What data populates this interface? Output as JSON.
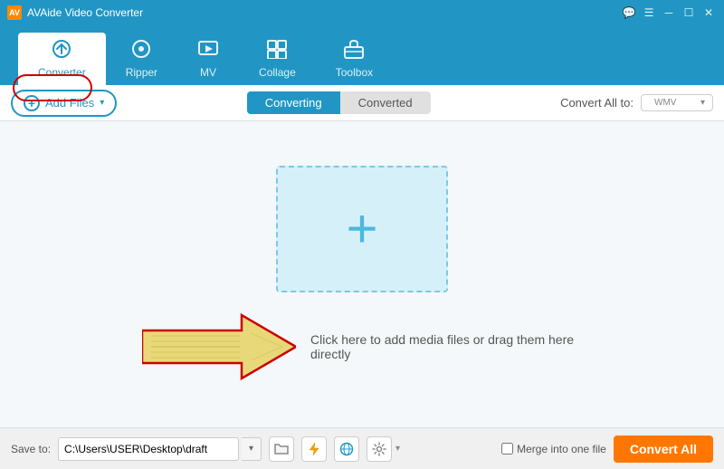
{
  "app": {
    "title": "AVAide Video Converter",
    "logo_text": "AV"
  },
  "titlebar": {
    "controls": [
      "⊟",
      "☐",
      "✕"
    ],
    "extra_icon": "⊞"
  },
  "nav": {
    "items": [
      {
        "label": "Converter",
        "icon": "⟳",
        "active": true
      },
      {
        "label": "Ripper",
        "icon": "◉"
      },
      {
        "label": "MV",
        "icon": "▣"
      },
      {
        "label": "Collage",
        "icon": "⊞"
      },
      {
        "label": "Toolbox",
        "icon": "🧰"
      }
    ]
  },
  "toolbar": {
    "add_files_label": "Add Files",
    "tabs": [
      {
        "label": "Converting",
        "active": true
      },
      {
        "label": "Converted",
        "active": false
      }
    ],
    "convert_all_to_label": "Convert All to:",
    "selected_format": "WMV"
  },
  "dropzone": {
    "plus_symbol": "+"
  },
  "hint": {
    "text": "Click here to add media files or drag them here directly"
  },
  "bottom_bar": {
    "save_to_label": "Save to:",
    "save_path": "C:\\Users\\USER\\Desktop\\draft",
    "merge_label": "Merge into one file",
    "convert_all_label": "Convert All"
  },
  "icons": {
    "folder": "📁",
    "spark": "⚡",
    "globe": "🌐",
    "settings": "⚙",
    "chevron_down": "▾"
  }
}
